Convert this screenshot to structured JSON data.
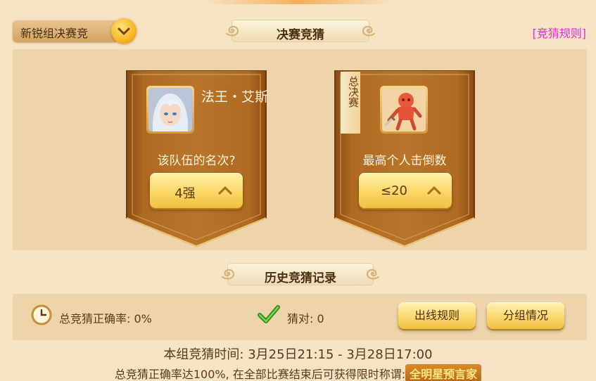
{
  "header": {
    "dropdown_label": "新锐组决赛竞",
    "title": "决赛竞猜",
    "rules_link": "[竞猜规则]"
  },
  "cards": [
    {
      "hero_name": "法王・艾斯",
      "question": "该队伍的名次?",
      "pick": "4强"
    },
    {
      "tag": "总决赛",
      "question": "最高个人击倒数",
      "pick": "≤20"
    }
  ],
  "history": {
    "title": "历史竞猜记录",
    "accuracy_label": "总竞猜正确率:",
    "accuracy_value": "0%",
    "correct_label": "猜对:",
    "correct_value": "0",
    "btn_lineup_rules": "出线规则",
    "btn_groups": "分组情况"
  },
  "footer": {
    "time": "本组竞猜时间: 3月25日21:15 - 3月28日17:00",
    "reward_text": "总竞猜正确率达100%, 在全部比赛结束后可获得限时称谓:",
    "reward_title": "全明星预言家"
  },
  "icons": {
    "dropdown": "chevron-down-icon",
    "pick": "chevron-up-icon",
    "clock": "clock-icon",
    "check": "checkmark-icon"
  },
  "colors": {
    "accent_gold": "#fbd768",
    "banner_brown": "#a9631d",
    "rules_link": "#e42fd0",
    "background": "#f6e3c3"
  }
}
